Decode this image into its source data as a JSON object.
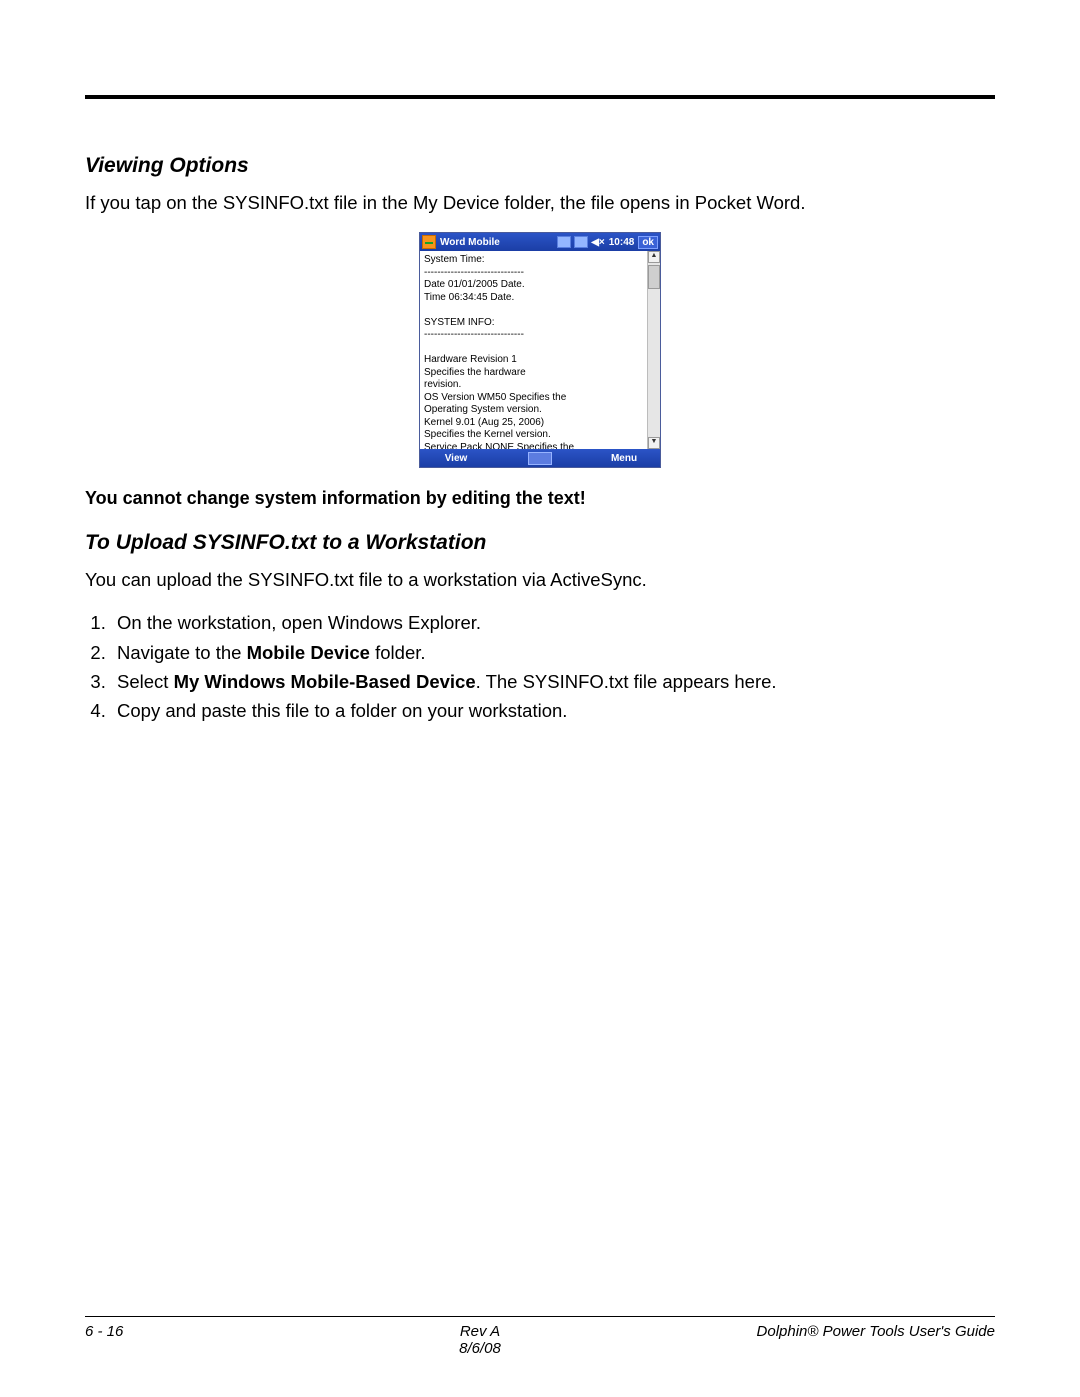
{
  "section1_heading": "Viewing Options",
  "section1_para": "If you tap on the SYSINFO.txt file in the My Device folder, the file opens in Pocket Word.",
  "warning": "You cannot change system information by editing the text!",
  "section2_heading": "To Upload SYSINFO.txt to a Workstation",
  "section2_para": "You can upload the SYSINFO.txt file to a workstation via ActiveSync.",
  "steps": {
    "s1": "On the workstation, open Windows Explorer.",
    "s2_a": "Navigate to the ",
    "s2_bold": "Mobile Device",
    "s2_b": " folder.",
    "s3_a": "Select ",
    "s3_bold": "My Windows Mobile-Based Device",
    "s3_b": ". The SYSINFO.txt file appears here.",
    "s4": "Copy and paste this file to a folder on your workstation."
  },
  "device": {
    "titlebar": {
      "app": "Word Mobile",
      "time": "10:48",
      "ok": "ok"
    },
    "content": "System Time:\n------------------------------\nDate    01/01/2005          Date.\nTime    06:34:45              Date.\n\nSYSTEM INFO:\n------------------------------\n\nHardware Revision          1\n          Specifies the hardware\nrevision.\nOS Version       WM50   Specifies the\nOperating System version.\nKernel   9.01 (Aug 25, 2006)\n          Specifies the Kernel version.\nService Pack      NONE    Specifies the\nService Pack level.",
    "menubar": {
      "left": "View",
      "right": "Menu"
    }
  },
  "footer": {
    "page": "6 - 16",
    "rev": "Rev A",
    "date": "8/6/08",
    "guide": "Dolphin® Power Tools User's Guide"
  }
}
